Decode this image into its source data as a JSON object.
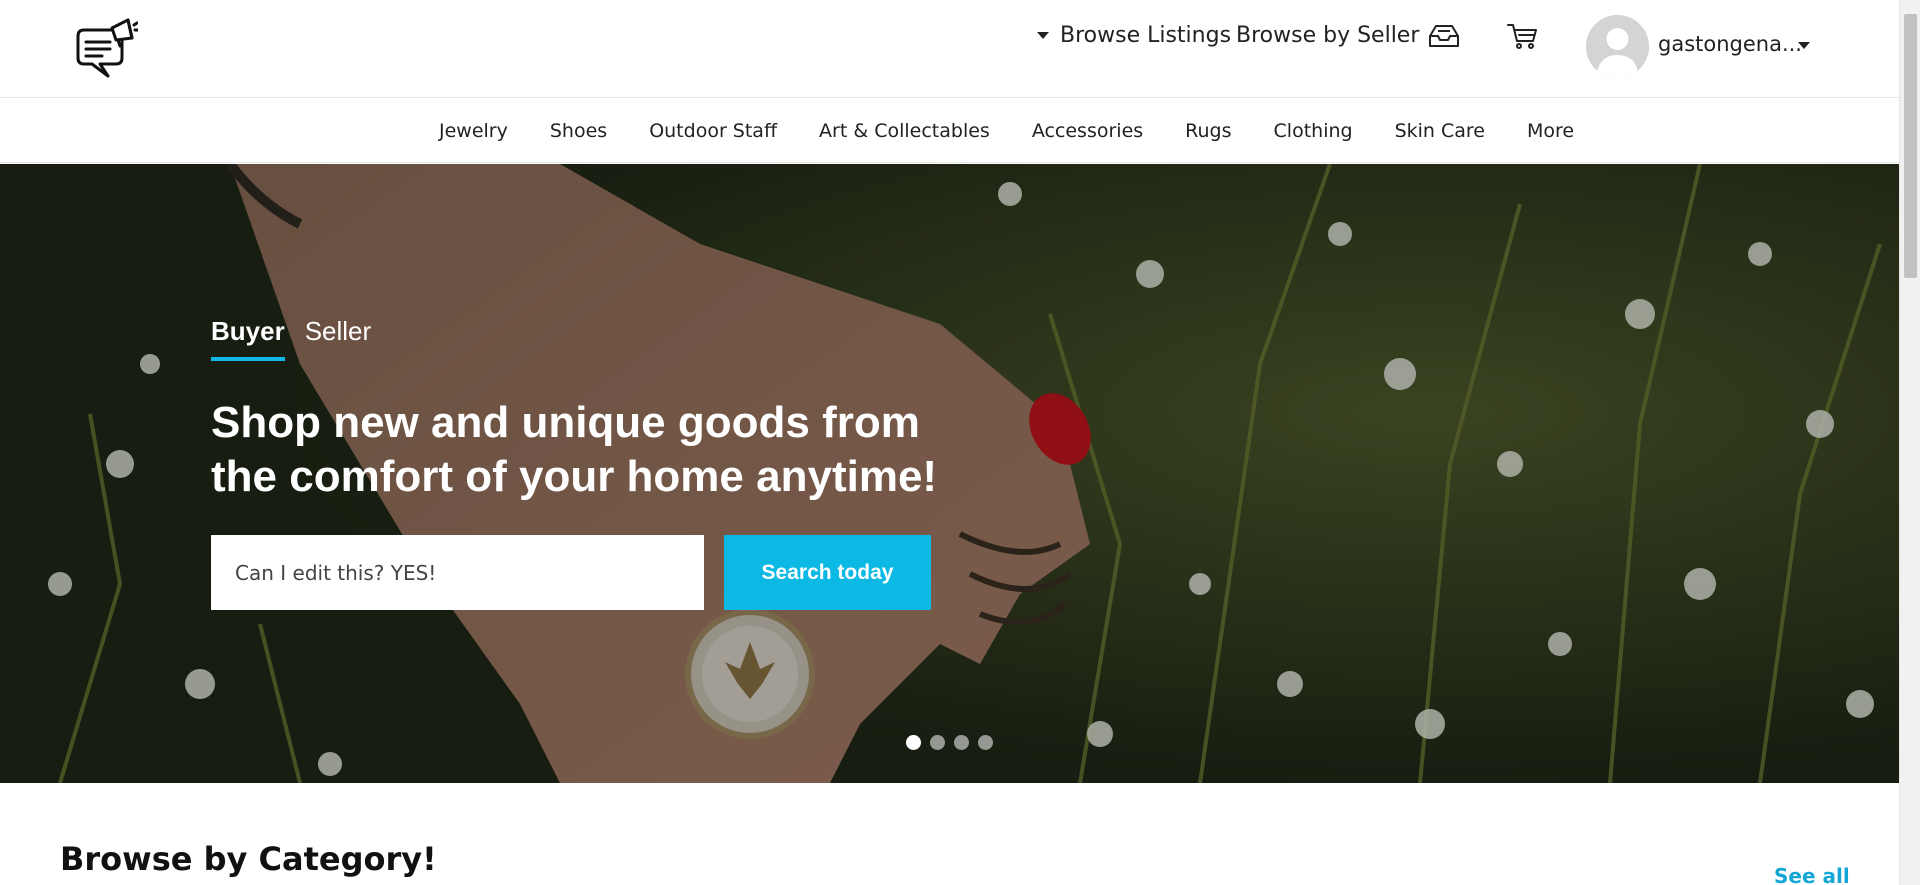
{
  "header": {
    "browse_listings": "Browse Listings",
    "browse_seller": "Browse by Seller",
    "username": "gastongena..."
  },
  "icons": {
    "logo": "chat-megaphone-logo",
    "inbox": "inbox-icon",
    "cart": "cart-icon",
    "avatar": "default-user-avatar"
  },
  "categories": [
    "Jewelry",
    "Shoes",
    "Outdoor Staff",
    "Art & Collectables",
    "Accessories",
    "Rugs",
    "Clothing",
    "Skin Care",
    "More"
  ],
  "hero": {
    "tabs": [
      {
        "label": "Buyer",
        "active": true
      },
      {
        "label": "Seller",
        "active": false
      }
    ],
    "headline_line1": "Shop new and unique goods from",
    "headline_line2": "the comfort of your home anytime!",
    "search_value": "Can I edit this? YES!",
    "search_button": "Search today",
    "slides": 4,
    "active_slide": 1
  },
  "sections": {
    "browse_category_title": "Browse by Category!",
    "see_all": "See all"
  },
  "colors": {
    "accent": "#0cb8e4",
    "link": "#14a7d6"
  }
}
